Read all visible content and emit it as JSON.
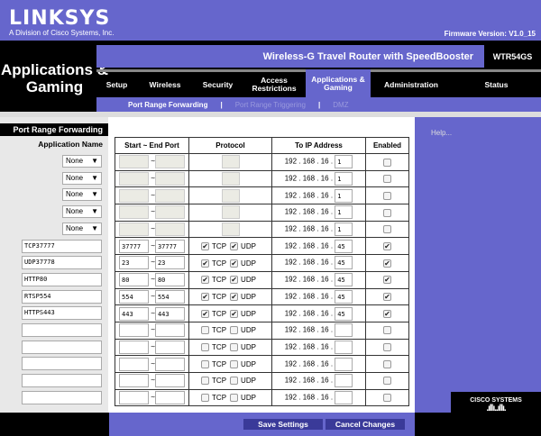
{
  "brand": {
    "logo": "LINKSYS",
    "tagline": "A Division of Cisco Systems, Inc.",
    "firmware": "Firmware Version: V1.0_15"
  },
  "header": {
    "section": "Applications & Gaming",
    "product": "Wireless-G Travel Router with SpeedBooster",
    "model": "WTR54GS"
  },
  "nav": [
    {
      "label": "Setup"
    },
    {
      "label": "Wireless"
    },
    {
      "label": "Security"
    },
    {
      "label": "Access Restrictions"
    },
    {
      "label": "Applications & Gaming",
      "active": true
    },
    {
      "label": "Administration"
    },
    {
      "label": "Status"
    }
  ],
  "subnav": [
    {
      "label": "Port Range Forwarding",
      "active": true
    },
    {
      "label": "Port Range Triggering"
    },
    {
      "label": "DMZ"
    }
  ],
  "sidebar": {
    "title": "Port Range Forwarding",
    "app_name_label": "Application Name"
  },
  "table": {
    "headers": [
      "Start ~ End Port",
      "Protocol",
      "To IP Address",
      "Enabled"
    ],
    "ip_prefix": "192 . 168 . 16 .",
    "tcp": "TCP",
    "udp": "UDP",
    "tilde": "~",
    "rows": [
      {
        "app": "None",
        "preset": true,
        "start": "",
        "end": "",
        "tcp": false,
        "udp": false,
        "ip": "1",
        "enabled": false
      },
      {
        "app": "None",
        "preset": true,
        "start": "",
        "end": "",
        "tcp": false,
        "udp": false,
        "ip": "1",
        "enabled": false
      },
      {
        "app": "None",
        "preset": true,
        "start": "",
        "end": "",
        "tcp": false,
        "udp": false,
        "ip": "1",
        "enabled": false
      },
      {
        "app": "None",
        "preset": true,
        "start": "",
        "end": "",
        "tcp": false,
        "udp": false,
        "ip": "1",
        "enabled": false
      },
      {
        "app": "None",
        "preset": true,
        "start": "",
        "end": "",
        "tcp": false,
        "udp": false,
        "ip": "1",
        "enabled": false
      },
      {
        "app": "TCP37777",
        "start": "37777",
        "end": "37777",
        "tcp": true,
        "udp": true,
        "ip": "45",
        "enabled": true
      },
      {
        "app": "UDP37778",
        "start": "23",
        "end": "23",
        "tcp": true,
        "udp": true,
        "ip": "45",
        "enabled": true
      },
      {
        "app": "HTTP80",
        "start": "80",
        "end": "80",
        "tcp": true,
        "udp": true,
        "ip": "45",
        "enabled": true
      },
      {
        "app": "RTSP554",
        "start": "554",
        "end": "554",
        "tcp": true,
        "udp": true,
        "ip": "45",
        "enabled": true
      },
      {
        "app": "HTTPS443",
        "start": "443",
        "end": "443",
        "tcp": true,
        "udp": true,
        "ip": "45",
        "enabled": true
      },
      {
        "app": "",
        "start": "",
        "end": "",
        "tcp": false,
        "udp": false,
        "ip": "",
        "enabled": false
      },
      {
        "app": "",
        "start": "",
        "end": "",
        "tcp": false,
        "udp": false,
        "ip": "",
        "enabled": false
      },
      {
        "app": "",
        "start": "",
        "end": "",
        "tcp": false,
        "udp": false,
        "ip": "",
        "enabled": false
      },
      {
        "app": "",
        "start": "",
        "end": "",
        "tcp": false,
        "udp": false,
        "ip": "",
        "enabled": false
      },
      {
        "app": "",
        "start": "",
        "end": "",
        "tcp": false,
        "udp": false,
        "ip": "",
        "enabled": false
      }
    ]
  },
  "help": {
    "label": "Help..."
  },
  "footer": {
    "save": "Save Settings",
    "cancel": "Cancel Changes",
    "cisco": "CISCO SYSTEMS"
  },
  "colors": {
    "brand_purple": "#6666cc",
    "button": "#3a3a99"
  }
}
